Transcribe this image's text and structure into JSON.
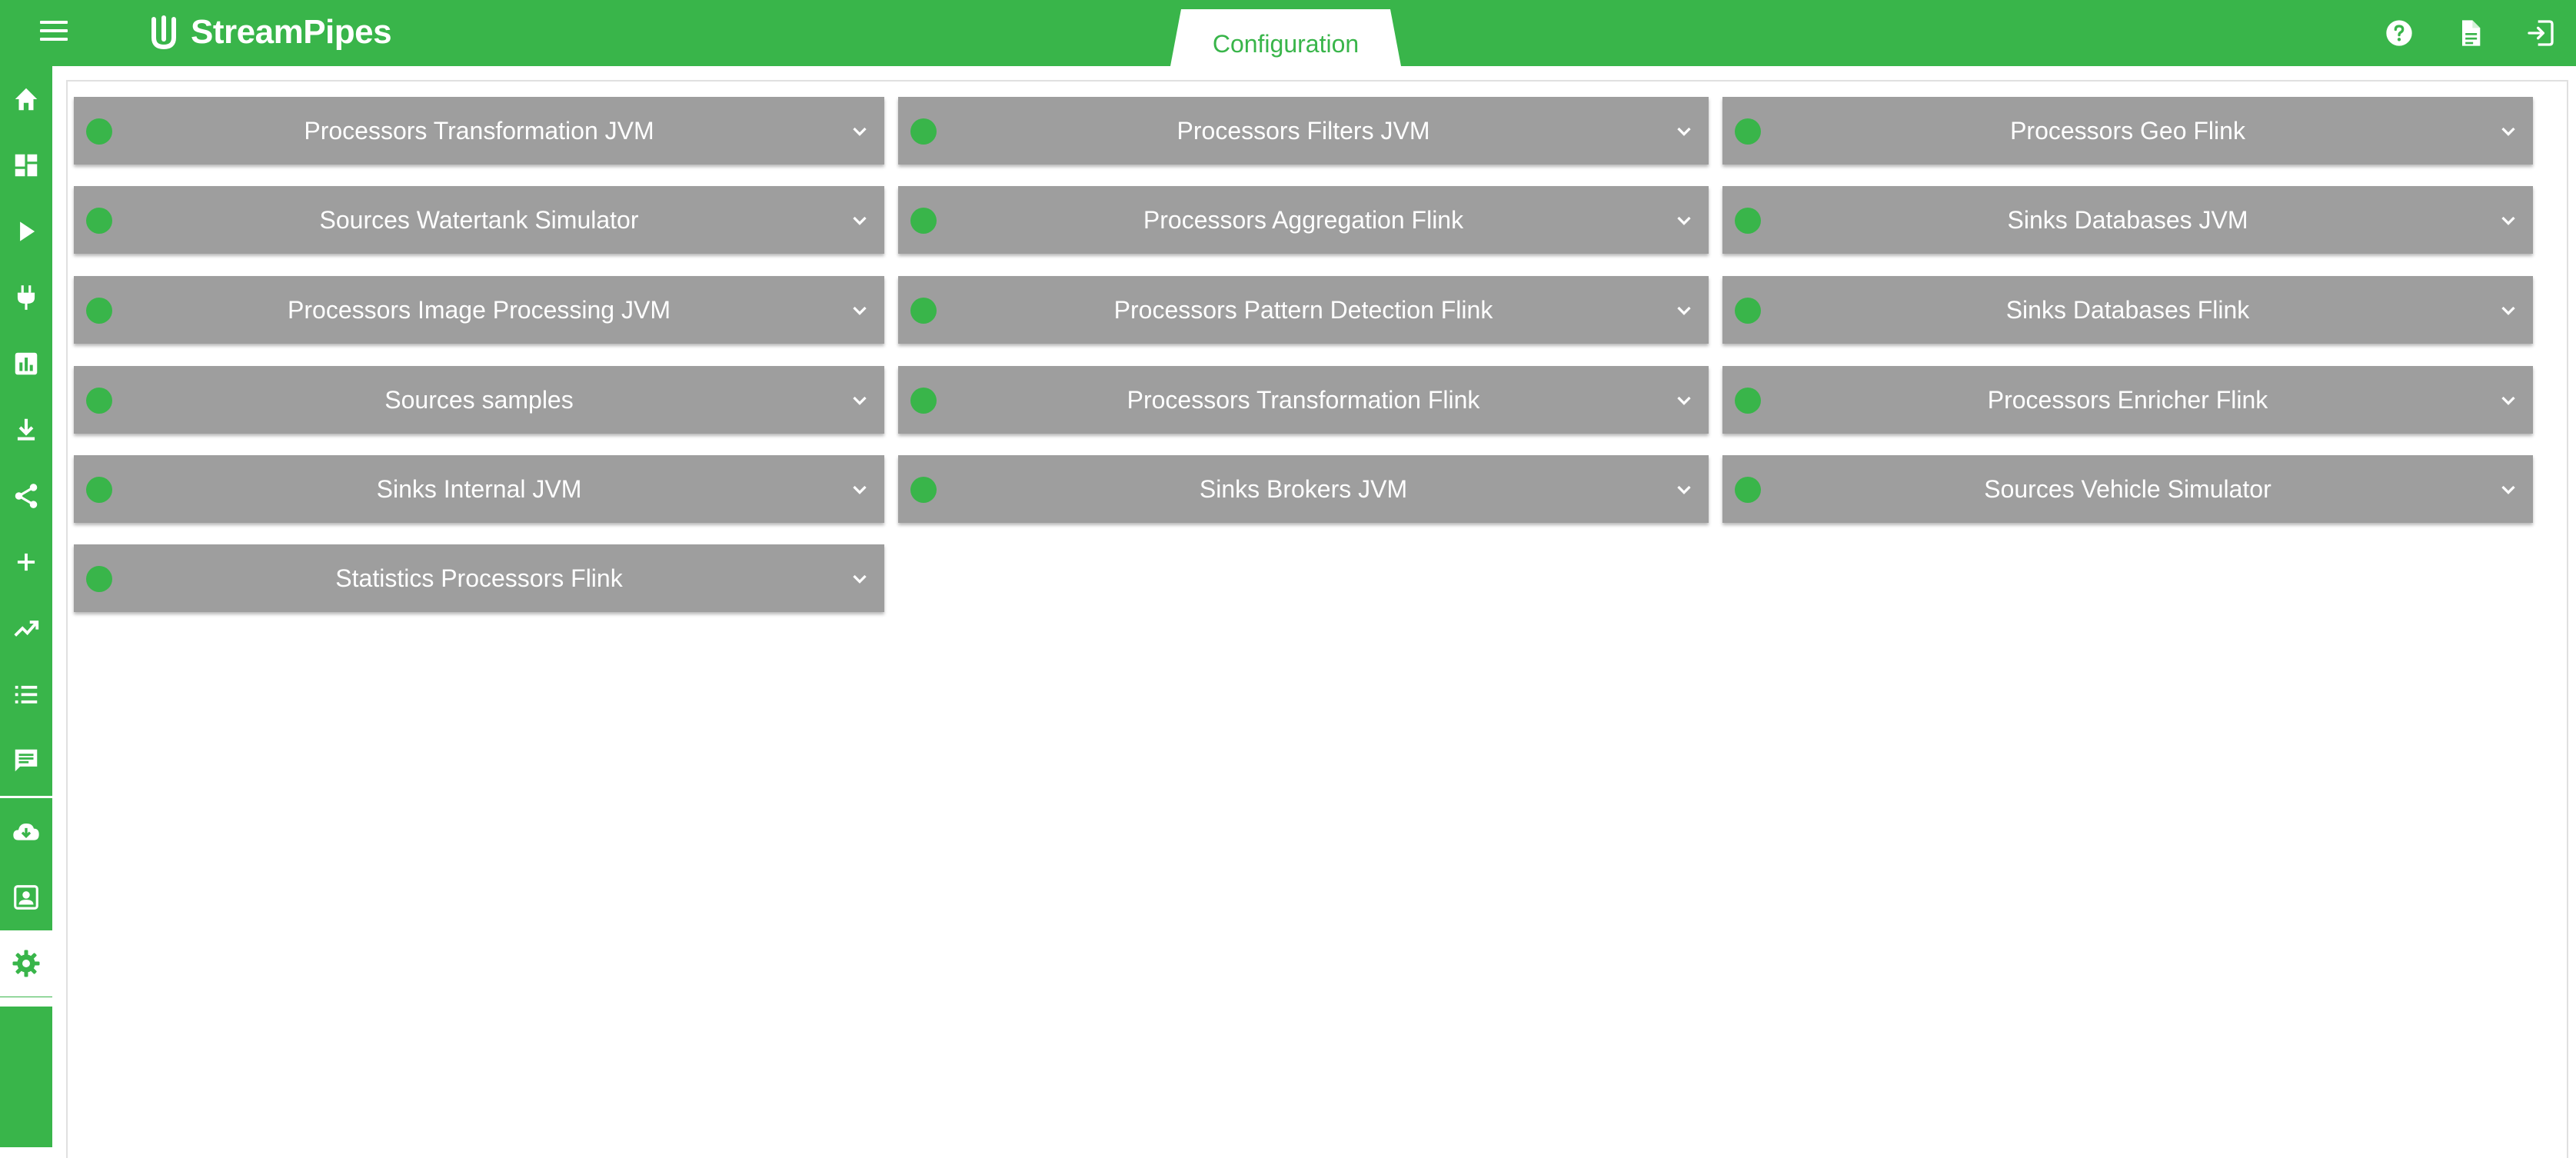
{
  "app": {
    "name": "StreamPipes",
    "active_tab": "Configuration",
    "accent_color": "#39b54a"
  },
  "header_icons": [
    "help-icon",
    "document-icon",
    "logout-icon"
  ],
  "sidebar": {
    "items": [
      {
        "icon": "home-icon"
      },
      {
        "icon": "dashboard-icon"
      },
      {
        "icon": "play-icon"
      },
      {
        "icon": "plug-icon"
      },
      {
        "icon": "bar-chart-icon"
      },
      {
        "icon": "download-icon"
      },
      {
        "icon": "share-icon"
      },
      {
        "icon": "plus-icon"
      },
      {
        "icon": "trending-up-icon"
      },
      {
        "icon": "list-icon"
      },
      {
        "icon": "chat-icon"
      },
      {
        "icon": "cloud-download-icon"
      },
      {
        "icon": "account-box-icon"
      },
      {
        "icon": "settings-icon",
        "active": true
      }
    ]
  },
  "services": [
    {
      "name": "Processors Transformation JVM",
      "status": "running"
    },
    {
      "name": "Processors Filters JVM",
      "status": "running"
    },
    {
      "name": "Processors Geo Flink",
      "status": "running"
    },
    {
      "name": "Sources Watertank Simulator",
      "status": "running"
    },
    {
      "name": "Processors Aggregation Flink",
      "status": "running"
    },
    {
      "name": "Sinks Databases JVM",
      "status": "running"
    },
    {
      "name": "Processors Image Processing JVM",
      "status": "running"
    },
    {
      "name": "Processors Pattern Detection Flink",
      "status": "running"
    },
    {
      "name": "Sinks Databases Flink",
      "status": "running"
    },
    {
      "name": "Sources samples",
      "status": "running"
    },
    {
      "name": "Processors Transformation Flink",
      "status": "running"
    },
    {
      "name": "Processors Enricher Flink",
      "status": "running"
    },
    {
      "name": "Sinks Internal JVM",
      "status": "running"
    },
    {
      "name": "Sinks Brokers JVM",
      "status": "running"
    },
    {
      "name": "Sources Vehicle Simulator",
      "status": "running"
    },
    {
      "name": "Statistics Processors Flink",
      "status": "running"
    }
  ]
}
